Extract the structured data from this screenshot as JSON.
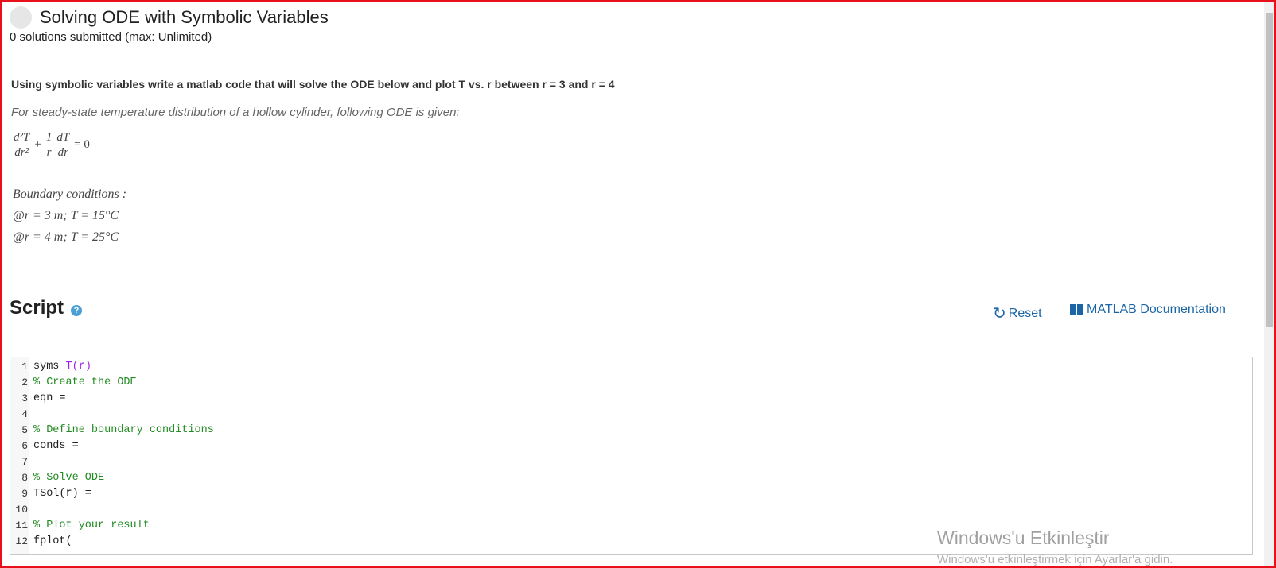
{
  "header": {
    "title": "Solving ODE with Symbolic Variables",
    "subtitle": "0 solutions submitted (max: Unlimited)"
  },
  "problem": {
    "statement": "Using symbolic variables write a matlab code that will solve the ODE below and plot T vs. r between r = 3 and r = 4",
    "description": "For steady-state temperature distribution of a hollow cylinder, following ODE is given:",
    "ode": {
      "term1_num": "d²T",
      "term1_den": "dr²",
      "plus": "+",
      "term2_num": "1",
      "term2_den": "r",
      "term3_num": "dT",
      "term3_den": "dr",
      "rhs": "= 0"
    },
    "boundary_title": "Boundary conditions :",
    "boundary_1": "@r = 3 m; T = 15°C",
    "boundary_2": "@r = 4 m; T = 25°C"
  },
  "script": {
    "title": "Script",
    "help_icon": "?",
    "reset_label": "Reset",
    "reset_icon": "↻",
    "doc_label": "MATLAB Documentation"
  },
  "editor": {
    "lines": [
      {
        "n": "1",
        "pre": "syms ",
        "var": "T(r)",
        "comment": "",
        "text": ""
      },
      {
        "n": "2",
        "pre": "",
        "var": "",
        "comment": "% Create the ODE",
        "text": ""
      },
      {
        "n": "3",
        "pre": "",
        "var": "",
        "comment": "",
        "text": "eqn ="
      },
      {
        "n": "4",
        "pre": "",
        "var": "",
        "comment": "",
        "text": ""
      },
      {
        "n": "5",
        "pre": "",
        "var": "",
        "comment": "% Define boundary conditions",
        "text": ""
      },
      {
        "n": "6",
        "pre": "",
        "var": "",
        "comment": "",
        "text": "conds ="
      },
      {
        "n": "7",
        "pre": "",
        "var": "",
        "comment": "",
        "text": ""
      },
      {
        "n": "8",
        "pre": "",
        "var": "",
        "comment": "% Solve ODE",
        "text": ""
      },
      {
        "n": "9",
        "pre": "",
        "var": "",
        "comment": "",
        "text": "TSol(r) ="
      },
      {
        "n": "10",
        "pre": "",
        "var": "",
        "comment": "",
        "text": ""
      },
      {
        "n": "11",
        "pre": "",
        "var": "",
        "comment": "% Plot your result",
        "text": ""
      },
      {
        "n": "12",
        "pre": "",
        "var": "",
        "comment": "",
        "text": "fplot("
      }
    ]
  },
  "watermark": {
    "line1": "Windows'u Etkinleştir",
    "line2": "Windows'u etkinleştirmek için Ayarlar'a gidin."
  }
}
